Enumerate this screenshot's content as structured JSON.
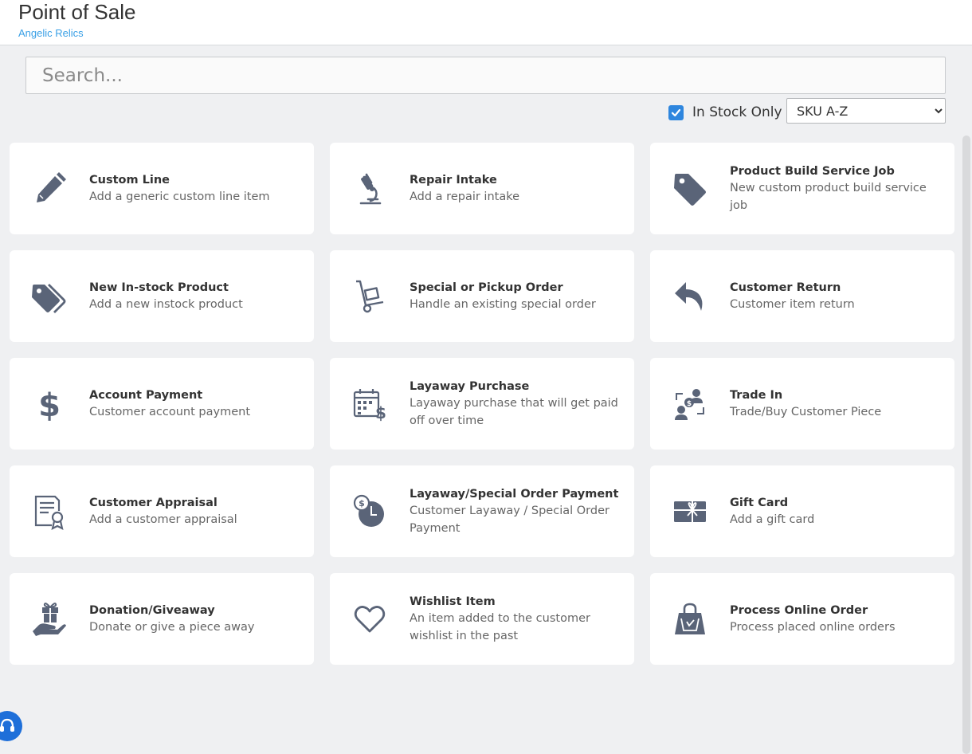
{
  "header": {
    "title": "Point of Sale",
    "store_name": "Angelic Relics"
  },
  "search": {
    "placeholder": "Search...",
    "value": ""
  },
  "filters": {
    "in_stock_only_label": "In Stock Only",
    "in_stock_only_checked": true,
    "sort_selected": "SKU A-Z"
  },
  "colors": {
    "accent": "#2e86de",
    "store_link": "#3aa0e6",
    "icon": "#5a6478"
  },
  "actions": [
    {
      "title": "Custom Line",
      "desc": "Add a generic custom line item",
      "icon": "pencil-icon"
    },
    {
      "title": "Repair Intake",
      "desc": "Add a repair intake",
      "icon": "microscope-icon"
    },
    {
      "title": "Product Build Service Job",
      "desc": "New custom product build service job",
      "icon": "tag-icon"
    },
    {
      "title": "New In-stock Product",
      "desc": "Add a new instock product",
      "icon": "tags-icon"
    },
    {
      "title": "Special or Pickup Order",
      "desc": "Handle an existing special order",
      "icon": "hand-truck-icon"
    },
    {
      "title": "Customer Return",
      "desc": "Customer item return",
      "icon": "reply-arrow-icon"
    },
    {
      "title": "Account Payment",
      "desc": "Customer account payment",
      "icon": "dollar-icon"
    },
    {
      "title": "Layaway Purchase",
      "desc": "Layaway purchase that will get paid off over time",
      "icon": "calendar-dollar-icon"
    },
    {
      "title": "Trade In",
      "desc": "Trade/Buy Customer Piece",
      "icon": "trade-exchange-icon"
    },
    {
      "title": "Customer Appraisal",
      "desc": "Add a customer appraisal",
      "icon": "certificate-icon"
    },
    {
      "title": "Layaway/Special Order Payment",
      "desc": "Customer Layaway / Special Order Payment",
      "icon": "clock-coin-icon"
    },
    {
      "title": "Gift Card",
      "desc": "Add a gift card",
      "icon": "gift-card-icon"
    },
    {
      "title": "Donation/Giveaway",
      "desc": "Donate or give a piece away",
      "icon": "gift-hand-icon"
    },
    {
      "title": "Wishlist Item",
      "desc": "An item added to the customer wishlist in the past",
      "icon": "heart-icon"
    },
    {
      "title": "Process Online Order",
      "desc": "Process placed online orders",
      "icon": "shopping-bag-icon"
    }
  ]
}
